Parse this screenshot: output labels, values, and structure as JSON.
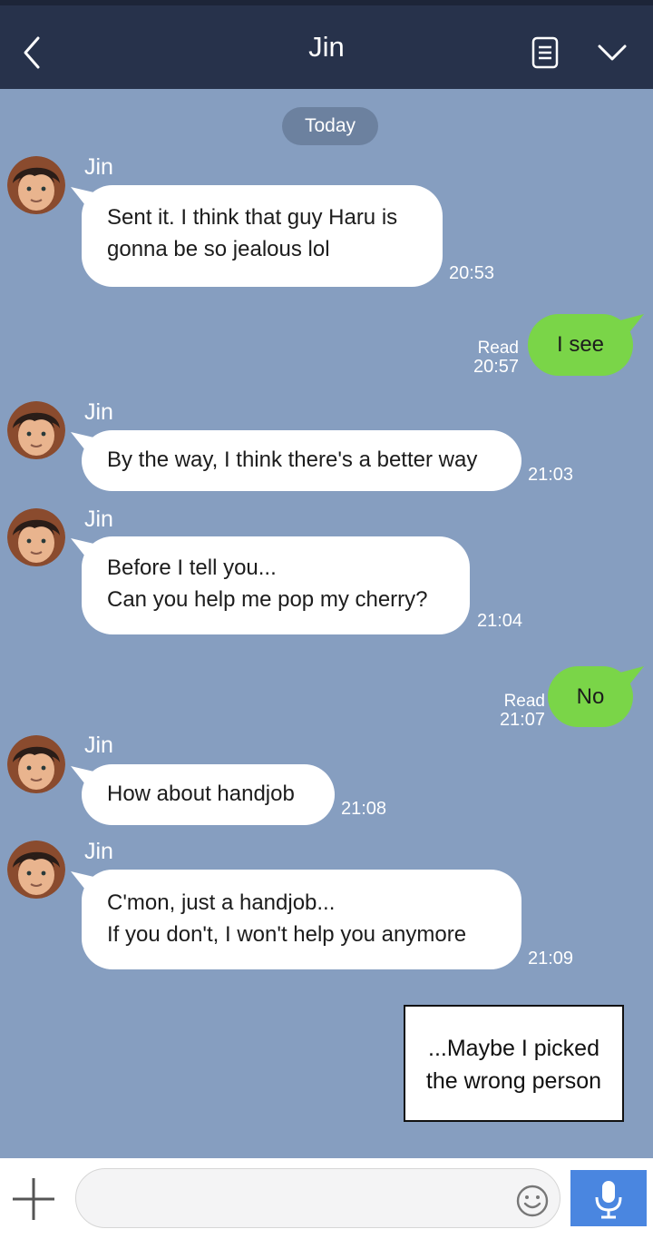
{
  "header": {
    "title": "Jin"
  },
  "date_divider": "Today",
  "messages": [
    {
      "sender": "Jin",
      "text": "Sent it. I think that guy Haru is\ngonna be so jealous lol",
      "time": "20:53"
    },
    {
      "text": "I see",
      "read": "Read",
      "time": "20:57"
    },
    {
      "sender": "Jin",
      "text": "By the way, I think there's a better way",
      "time": "21:03"
    },
    {
      "sender": "Jin",
      "text": "Before I tell you...\nCan you help me pop my cherry?",
      "time": "21:04"
    },
    {
      "text": "No",
      "read": "Read",
      "time": "21:07"
    },
    {
      "sender": "Jin",
      "text": "How about handjob",
      "time": "21:08"
    },
    {
      "sender": "Jin",
      "text": "C'mon, just a handjob...\nIf you don't, I won't help you anymore",
      "time": "21:09"
    }
  ],
  "caption": "...Maybe I picked\nthe wrong person",
  "composer": {
    "placeholder": ""
  },
  "icons": {
    "back": "chevron-left-icon",
    "notes": "notes-icon",
    "menu": "chevron-down-icon",
    "add": "plus-icon",
    "emoji": "smiley-icon",
    "mic": "microphone-icon"
  },
  "colors": {
    "header_bg": "#27324b",
    "chat_bg": "#869ec0",
    "incoming_bubble": "#ffffff",
    "outgoing_bubble": "#7ad548",
    "mic_button": "#4a86e0"
  }
}
